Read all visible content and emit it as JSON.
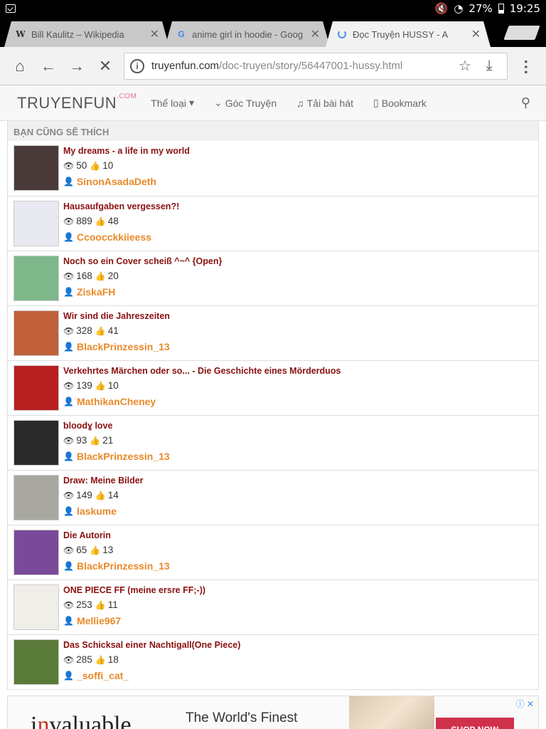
{
  "status": {
    "battery": "27%",
    "time": "19:25"
  },
  "tabs": [
    {
      "title": "Bill Kaulitz – Wikipedia",
      "favicon": "wikipedia-icon"
    },
    {
      "title": "anime girl in hoodie - Goog",
      "favicon": "google-icon"
    },
    {
      "title": "Đọc Truyện HUSSY - A",
      "favicon": "loading-spinner-icon"
    }
  ],
  "omnibox": {
    "domain": "truyenfun.com",
    "path": "/doc-truyen/story/56447001-hussy.html"
  },
  "site": {
    "logo": "TRUYENFUN",
    "logo_sup": ".COM",
    "nav": [
      "Thể loại",
      "Góc Truyện",
      "Tải bài hát",
      "Bookmark"
    ]
  },
  "panel": {
    "heading": "BẠN CŨNG SẼ THÍCH",
    "items": [
      {
        "title": "My dreams - a life in my world",
        "views": "50",
        "likes": "10",
        "author": "SinonAsadaDeth",
        "thumb": "#4a3a3a"
      },
      {
        "title": "Hausaufgaben vergessen?!",
        "views": "889",
        "likes": "48",
        "author": "Ccoocckkiieess",
        "thumb": "#e8e8f0"
      },
      {
        "title": "Noch so ein Cover scheiß ^~^ {Open}",
        "views": "168",
        "likes": "20",
        "author": "ZiskaFH",
        "thumb": "#7fb88a"
      },
      {
        "title": "Wir sind die Jahreszeiten",
        "views": "328",
        "likes": "41",
        "author": "BlackPrinzessin_13",
        "thumb": "#c0603a"
      },
      {
        "title": "Verkehrtes Märchen oder so... - Die Geschichte eines Mörderduos",
        "views": "139",
        "likes": "10",
        "author": "MathikanCheney",
        "thumb": "#b82020"
      },
      {
        "title": "ƅloodɣ love",
        "views": "93",
        "likes": "21",
        "author": "BlackPrinzessin_13",
        "thumb": "#2a2a2a"
      },
      {
        "title": "Draw: Meine Bilder",
        "views": "149",
        "likes": "14",
        "author": "laskume",
        "thumb": "#a8a8a0"
      },
      {
        "title": "Die Autorin",
        "views": "65",
        "likes": "13",
        "author": "BlackPrinzessin_13",
        "thumb": "#7a4a9a"
      },
      {
        "title": "ONE PIECE FF (meine ersre FF;-))",
        "views": "253",
        "likes": "11",
        "author": "Mellie967",
        "thumb": "#f0eee8"
      },
      {
        "title": "Das Schicksal einer Nachtigall(One Piece)",
        "views": "285",
        "likes": "18",
        "author": "_soffi_cat_",
        "thumb": "#5a7a3a"
      }
    ]
  },
  "ad": {
    "brand_pre": "i",
    "brand_red": "n",
    "brand_post": "valuable",
    "text": "The World's Finest",
    "cta": "SHOP NOW"
  }
}
